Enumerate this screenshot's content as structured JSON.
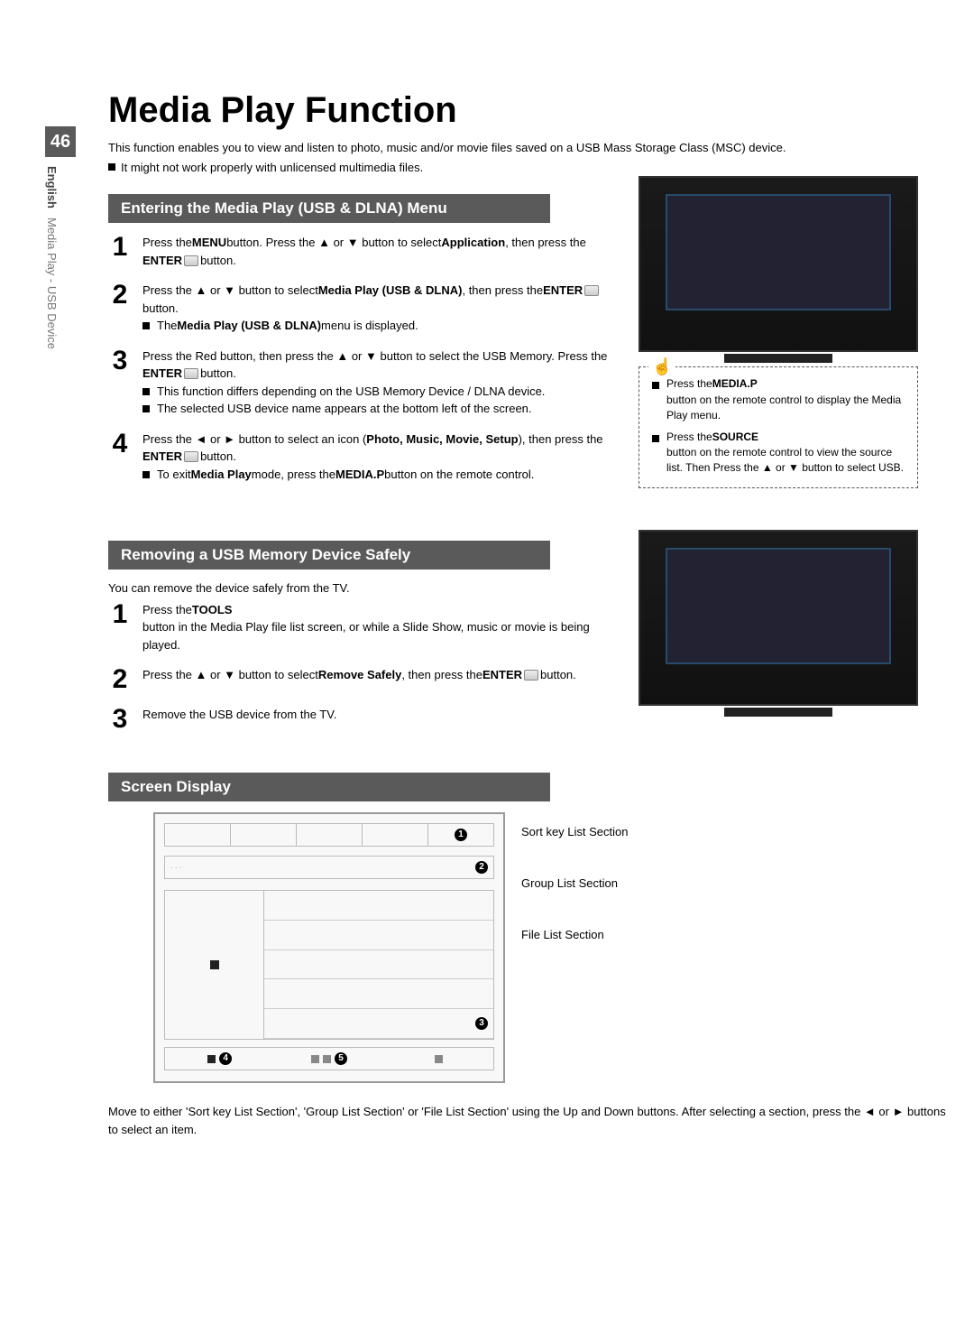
{
  "page_number": "46",
  "side_label_lang": "English",
  "side_label_section": "Media Play - USB Device",
  "title": "Media Play Function",
  "intro": "This function enables you to view and listen to photo, music and/or movie files saved on a USB Mass Storage Class (MSC) device.",
  "intro_note": "It might not work properly with unlicensed multimedia files.",
  "section1": {
    "title": "Entering the Media Play (USB & DLNA) Menu",
    "step1_a": "Press the ",
    "step1_menu": "MENU",
    "step1_b": " button. Press the ▲ or ▼ button to select ",
    "step1_app": "Application",
    "step1_c": ", then press the ",
    "step1_enter": "ENTER",
    "step1_d": " button.",
    "step2_a": "Press the ▲ or ▼ button to select ",
    "step2_mp": "Media Play (USB & DLNA)",
    "step2_b": ", then press the ",
    "step2_enter": "ENTER",
    "step2_c": " button.",
    "step2_note_a": "The ",
    "step2_note_b": "Media Play (USB & DLNA)",
    "step2_note_c": " menu is displayed.",
    "step3_a": "Press the Red button, then press the ▲ or ▼ button to select the USB Memory. Press the ",
    "step3_enter": "ENTER",
    "step3_b": " button.",
    "step3_note1": "This function differs depending on the USB Memory Device / DLNA device.",
    "step3_note2": "The selected USB device name appears at the bottom left of the screen.",
    "step4_a": "Press the ◄ or ► button to select an icon (",
    "step4_icons": "Photo, Music, Movie, Setup",
    "step4_b": "), then press the ",
    "step4_enter": "ENTER",
    "step4_c": " button.",
    "step4_note_a": "To exit ",
    "step4_note_b": "Media Play",
    "step4_note_c": " mode, press the ",
    "step4_note_d": "MEDIA.P",
    "step4_note_e": " button on the remote control."
  },
  "tips": {
    "t1_a": "Press the ",
    "t1_b": "MEDIA.P",
    "t1_c": " button on the remote control to display the Media Play menu.",
    "t2_a": "Press the ",
    "t2_b": "SOURCE",
    "t2_c": " button on the remote control to view the source list. Then Press the ▲ or ▼ button to select USB."
  },
  "section2": {
    "title": "Removing a USB Memory Device Safely",
    "lead": "You can remove the device safely from the TV.",
    "step1_a": "Press the ",
    "step1_tools": "TOOLS",
    "step1_b": " button in the Media Play file list screen, or while a Slide Show, music or movie is being played.",
    "step2_a": "Press the ▲ or ▼ button to select ",
    "step2_rs": "Remove Safely",
    "step2_b": ", then press the ",
    "step2_enter": "ENTER",
    "step2_c": " button.",
    "step3": "Remove the USB device from the TV."
  },
  "section3": {
    "title": "Screen Display",
    "label_sort": "Sort key List Section",
    "label_group": "Group List Section",
    "label_file": "File List Section",
    "desc": "Move to either 'Sort key List Section', 'Group List Section' or 'File List Section' using the Up and Down buttons. After selecting a section, press the ◄ or ► buttons to select an item."
  },
  "step_numbers": {
    "n1": "1",
    "n2": "2",
    "n3": "3",
    "n4": "4"
  },
  "diagram_markers": {
    "c1": "1",
    "c2": "2",
    "c3": "3",
    "c4": "4",
    "c5": "5"
  }
}
